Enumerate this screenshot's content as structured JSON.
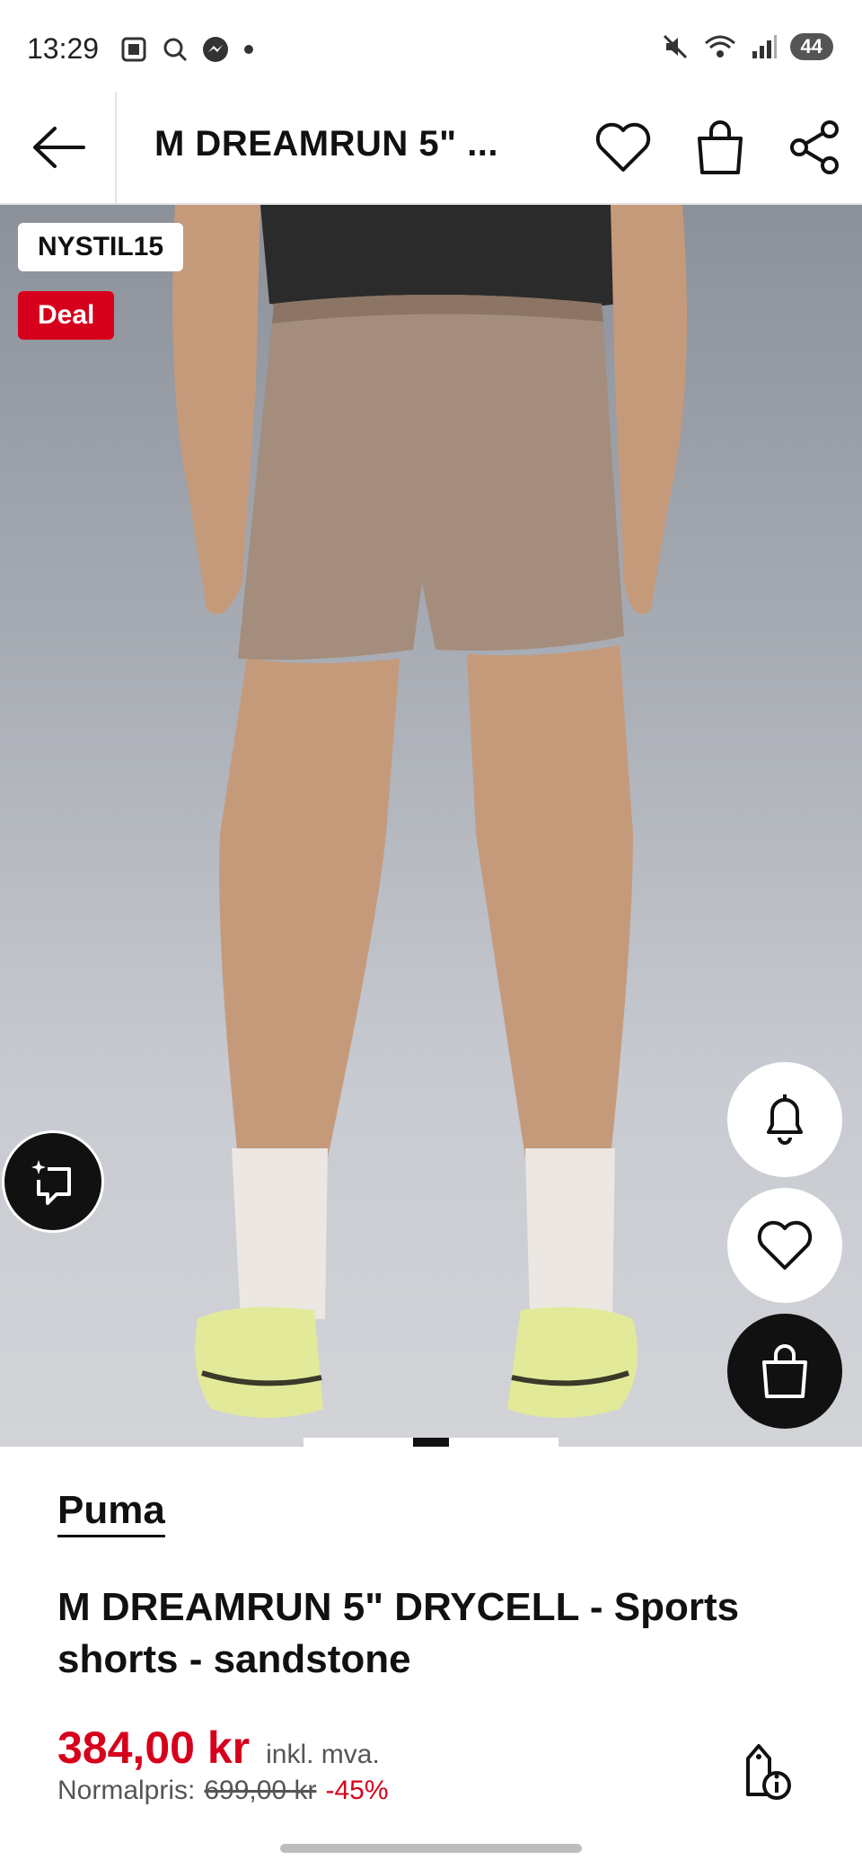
{
  "status_bar": {
    "time": "13:29",
    "battery": "44"
  },
  "header": {
    "title": "M DREAMRUN 5\" ..."
  },
  "badges": {
    "code": "NYSTIL15",
    "deal": "Deal"
  },
  "product": {
    "brand": "Puma",
    "name": "M DREAMRUN 5\" DRYCELL  - Sports shorts - sandstone",
    "price": "384,00 kr",
    "vat_note": "inkl. mva.",
    "normal_label": "Normalpris:",
    "old_price": "699,00 kr",
    "discount": "-45%"
  },
  "colors": {
    "accent": "#d6001c",
    "dark": "#111111"
  },
  "icons": [
    "back-arrow-icon",
    "heart-icon",
    "bag-icon",
    "share-icon",
    "bell-icon",
    "ai-search-icon",
    "price-info-icon"
  ]
}
